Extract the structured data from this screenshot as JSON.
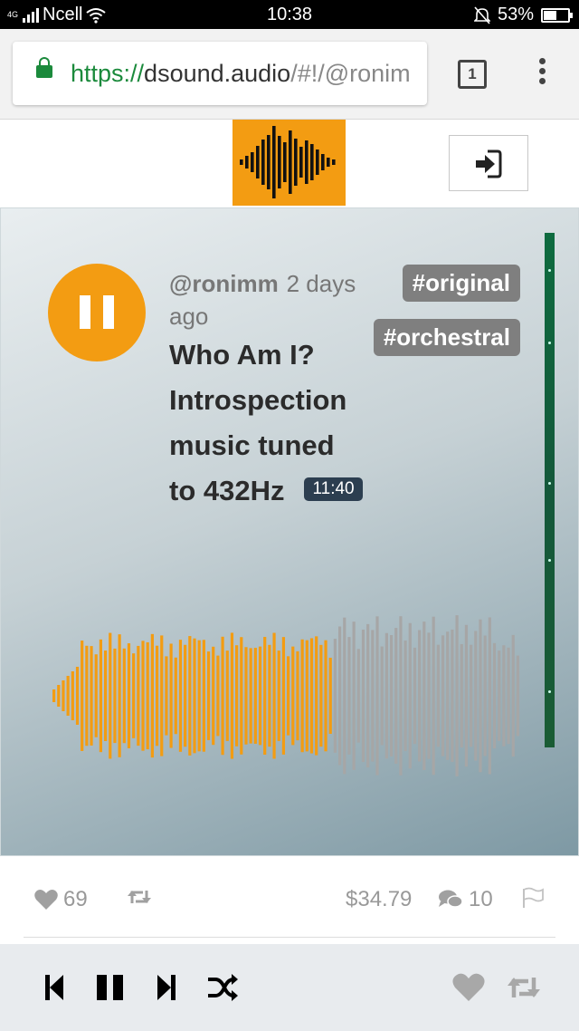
{
  "status_bar": {
    "network_type": "4G",
    "carrier": "Ncell",
    "time": "10:38",
    "battery": "53%",
    "battery_level": 0.53
  },
  "browser": {
    "url_scheme": "https://",
    "url_host": "dsound.audio",
    "url_path": "/#!/@ronim",
    "tab_count": "1"
  },
  "track": {
    "author": "@ronimm",
    "posted_ago": "2 days ago",
    "title": "Who Am I? Introspection music tuned to 432Hz",
    "duration": "11:40",
    "tags": [
      "#original",
      "#orchestral"
    ],
    "playing": true,
    "progress": 0.6
  },
  "stats": {
    "likes": "69",
    "payout": "$34.79",
    "comments": "10"
  },
  "colors": {
    "accent": "#f39c12",
    "tag_bg": "#7f7f7f",
    "duration_bg": "#2c3e50",
    "wave_played": "#f39c12",
    "wave_unplayed": "#a6a6a6"
  },
  "icons": {
    "play_state": "pause-icon",
    "login": "sign-in-icon",
    "like": "heart-icon",
    "resteem": "retweet-icon",
    "comments": "comments-icon",
    "flag": "flag-icon",
    "prev": "skip-back-icon",
    "next": "skip-forward-icon",
    "shuffle": "shuffle-icon"
  }
}
